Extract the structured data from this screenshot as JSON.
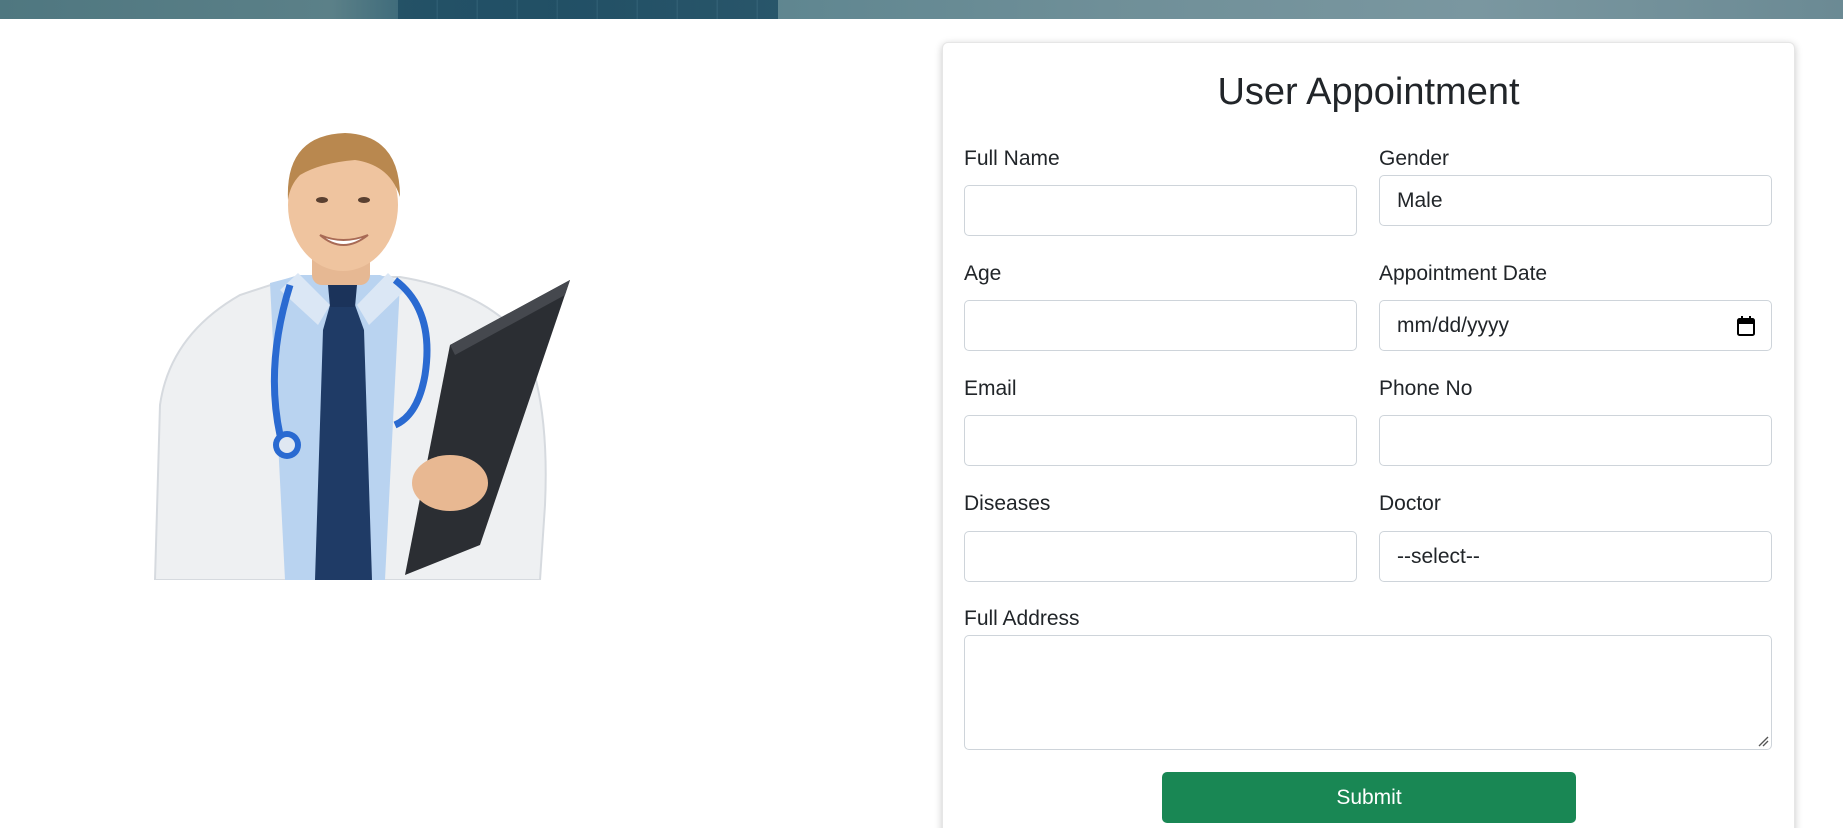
{
  "form": {
    "title": "User Appointment",
    "full_name": {
      "label": "Full Name",
      "value": ""
    },
    "gender": {
      "label": "Gender",
      "value": "Male"
    },
    "age": {
      "label": "Age",
      "value": ""
    },
    "appointment_date": {
      "label": "Appointment Date",
      "placeholder": "mm/dd/yyyy"
    },
    "email": {
      "label": "Email",
      "value": ""
    },
    "phone": {
      "label": "Phone No",
      "value": ""
    },
    "diseases": {
      "label": "Diseases",
      "value": ""
    },
    "doctor": {
      "label": "Doctor",
      "selected": "--select--"
    },
    "address": {
      "label": "Full Address",
      "value": ""
    },
    "submit_label": "Submit"
  },
  "colors": {
    "submit_bg": "#198754",
    "input_border": "#ced4da",
    "text": "#212529"
  },
  "icons": {
    "date": "calendar-icon",
    "resize": "resize-handle-icon"
  }
}
